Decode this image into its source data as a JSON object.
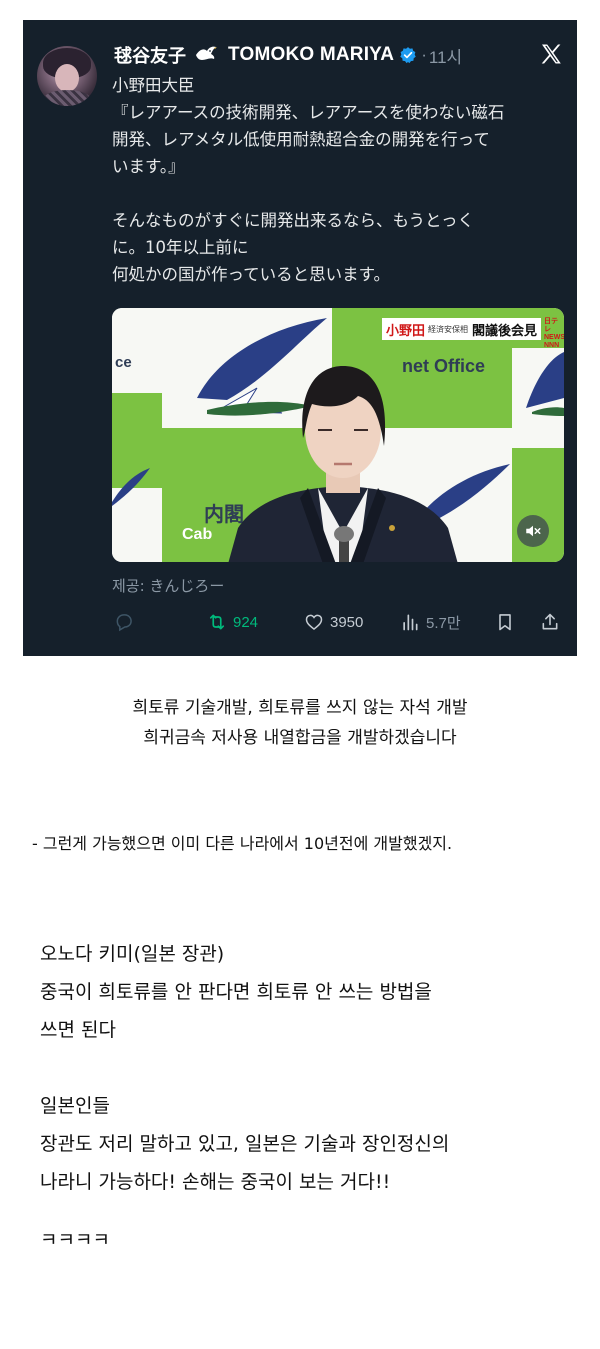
{
  "tweet": {
    "author_jp_name": "毬谷友子",
    "display_name": "TOMOKO MARIYA",
    "separator": "·",
    "time": "11시",
    "icons": {
      "avatar": "avatar",
      "emoji": "dove-icon",
      "verified": "verified-icon",
      "platform": "x-logo-icon"
    },
    "text_lines": [
      "小野田大臣",
      "『レアアースの技術開発、レアアースを使わない磁石",
      "開発、レアメタル低使用耐熱超合金の開発を行って",
      "います。』",
      "",
      "そんなものがすぐに開発出来るなら、もうとっく",
      "に。10年以上前に",
      "何処かの国が作っていると思います。"
    ],
    "video": {
      "ticker_name": "小野田",
      "ticker_role": "経済安保相",
      "ticker_event": "閣議後会見",
      "logo": "日テレ NEWS NNN",
      "backdrop_text_top": "内閣府",
      "backdrop_text_top_en": "net Office",
      "backdrop_text_left": "ce",
      "backdrop_text_bottom": "内閣",
      "backdrop_text_bottom_en": "Cab",
      "mute_icon": "speaker-muted-icon"
    },
    "provided_by": "제공: きんじろー",
    "actions": {
      "reply_icon": "reply-icon",
      "retweet_count": "924",
      "like_count": "3950",
      "views_count": "5.7만",
      "bookmark_icon": "bookmark-icon",
      "share_icon": "share-icon"
    },
    "colors": {
      "background": "#15202b",
      "retweet_active": "#00ba7c",
      "muted_text": "#8b98a5",
      "verified": "#1d9bf0"
    }
  },
  "commentary": {
    "translation_lines": [
      "희토류 기술개발, 희토류를 쓰지 않는 자석 개발",
      "희귀금속 저사용 내열합금을 개발하겠습니다"
    ],
    "reply_line": "- 그런게 가능했으면 이미 다른 나라에서 10년전에 개발했겠지.",
    "paragraph_lines": [
      "오노다 키미(일본 장관)",
      "중국이 희토류를 안 판다면 희토류 안 쓰는 방법을",
      "쓰면 된다",
      "",
      "일본인들",
      "장관도 저리 말하고 있고, 일본은 기술과 장인정신의",
      "나라니 가능하다! 손해는 중국이 보는 거다!!"
    ],
    "laugh": "ㅋㅋㅋㅋ"
  }
}
